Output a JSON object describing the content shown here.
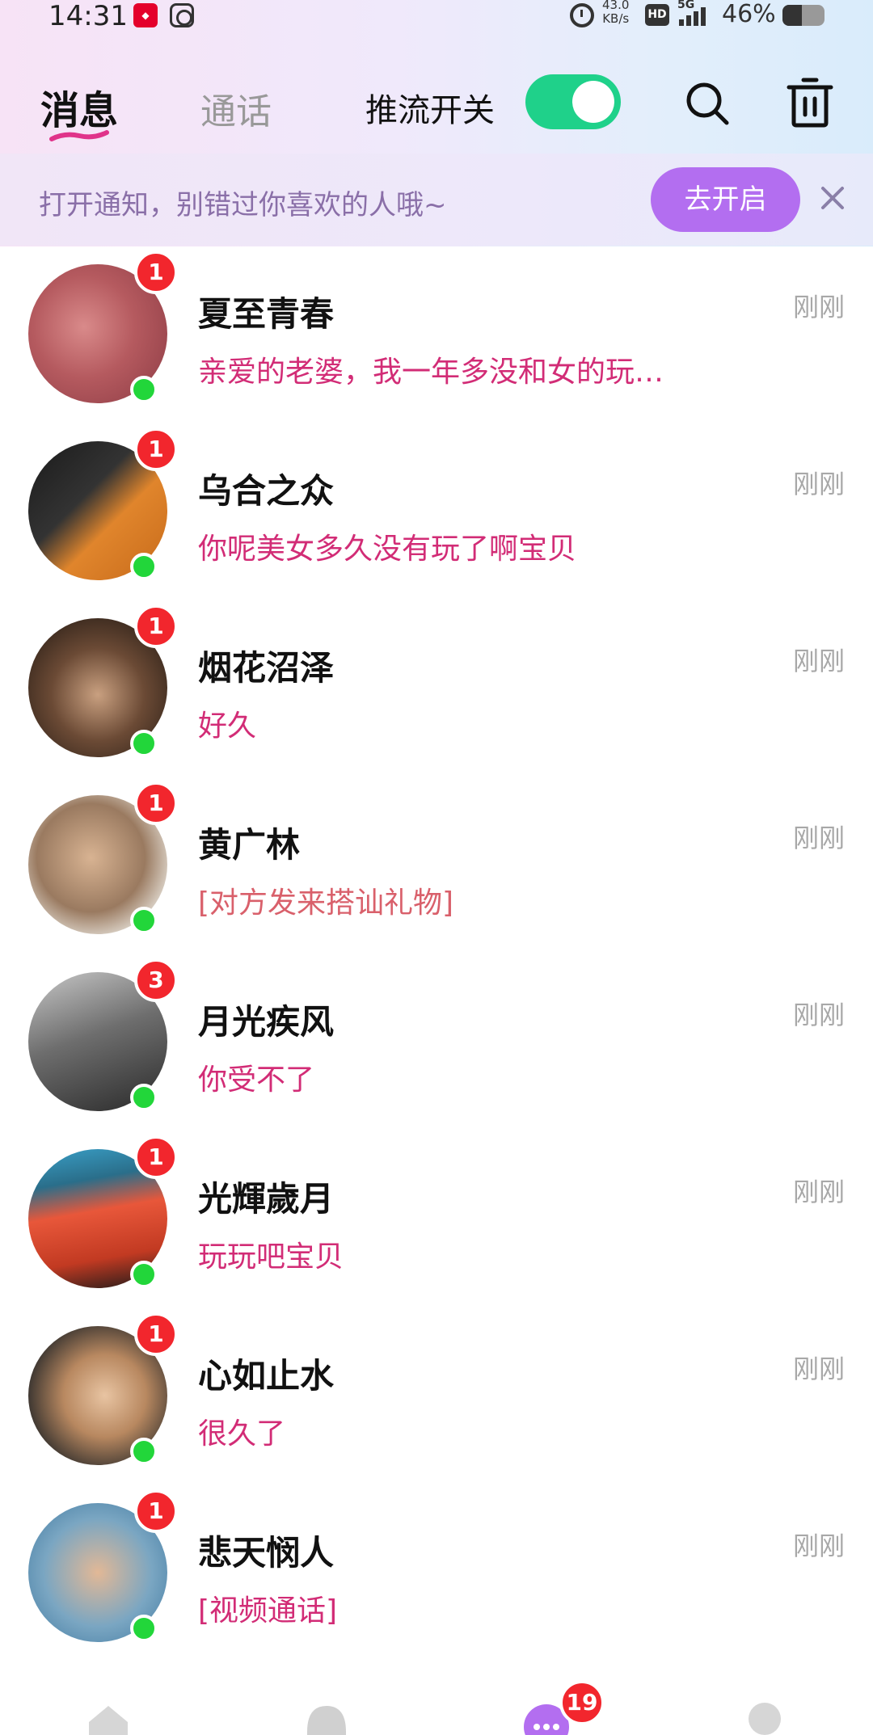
{
  "status_bar": {
    "time": "14:31",
    "net_speed_value": "43.0",
    "net_speed_unit": "KB/s",
    "hd_label": "HD",
    "network_type": "5G",
    "battery_percent": "46%",
    "battery_level": 0.46
  },
  "header": {
    "tab_messages": "消息",
    "tab_calls": "通话",
    "stream_switch_label": "推流开关",
    "stream_switch_on": true,
    "accent_color": "#1fd18a"
  },
  "notification": {
    "text": "打开通知，别错过你喜欢的人哦~",
    "button": "去开启"
  },
  "conversations": [
    {
      "name": "夏至青春",
      "preview": "亲爱的老婆，我一年多没和女的玩…",
      "time": "刚刚",
      "unread": "1",
      "online": true
    },
    {
      "name": "乌合之众",
      "preview": "你呢美女多久没有玩了啊宝贝",
      "time": "刚刚",
      "unread": "1",
      "online": true
    },
    {
      "name": "烟花沼泽",
      "preview": "好久",
      "time": "刚刚",
      "unread": "1",
      "online": true
    },
    {
      "name": "黄广林",
      "preview": "[对方发来搭讪礼物]",
      "time": "刚刚",
      "unread": "1",
      "online": true
    },
    {
      "name": "月光疾风",
      "preview": "你受不了",
      "time": "刚刚",
      "unread": "3",
      "online": true
    },
    {
      "name": "光輝歲月",
      "preview": "玩玩吧宝贝",
      "time": "刚刚",
      "unread": "1",
      "online": true
    },
    {
      "name": "心如止水",
      "preview": "很久了",
      "time": "刚刚",
      "unread": "1",
      "online": true
    },
    {
      "name": "悲天悯人",
      "preview": "[视频通话]",
      "time": "刚刚",
      "unread": "1",
      "online": true
    }
  ],
  "bottom_nav": {
    "messages_badge": "19"
  },
  "colors": {
    "unread_badge": "#f2262d",
    "online_dot": "#22d63a",
    "preview_text": "#d22c76",
    "notif_button": "#b36ef0"
  }
}
